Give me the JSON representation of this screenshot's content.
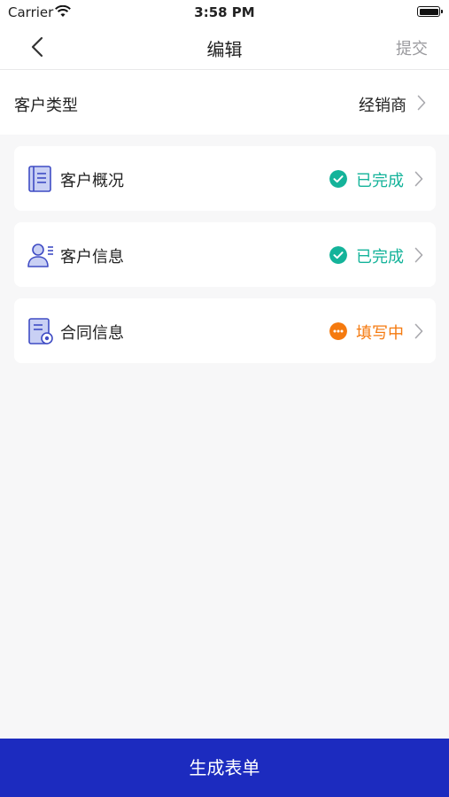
{
  "status_bar": {
    "carrier": "Carrier",
    "time": "3:58 PM"
  },
  "nav": {
    "title": "编辑",
    "submit_label": "提交"
  },
  "customer_type": {
    "label": "客户类型",
    "value": "经销商"
  },
  "cards": [
    {
      "label": "客户概况",
      "status": "已完成",
      "status_color": "#14b39a",
      "icon": "document-icon"
    },
    {
      "label": "客户信息",
      "status": "已完成",
      "status_color": "#14b39a",
      "icon": "user-profile-icon"
    },
    {
      "label": "合同信息",
      "status": "填写中",
      "status_color": "#f57a0f",
      "icon": "contract-icon"
    }
  ],
  "bottom_button": {
    "label": "生成表单"
  },
  "colors": {
    "primary": "#1c2bbf",
    "done": "#14b39a",
    "in_progress": "#f57a0f"
  }
}
